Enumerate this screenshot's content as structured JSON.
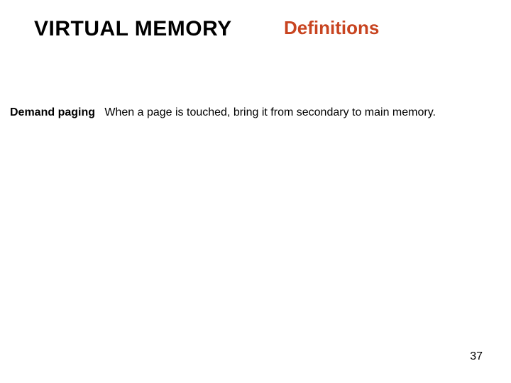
{
  "header": {
    "title": "VIRTUAL MEMORY",
    "subtitle": "Definitions"
  },
  "body": {
    "term": "Demand paging",
    "definition": "When a page is touched, bring it from secondary to main memory."
  },
  "page_number": "37"
}
